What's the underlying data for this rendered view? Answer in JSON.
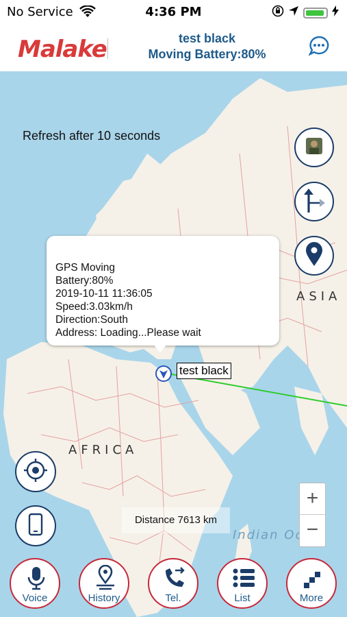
{
  "status_bar": {
    "carrier": "No Service",
    "time": "4:36 PM"
  },
  "header": {
    "logo_text": "Malake",
    "title": "test black",
    "subtitle": "Moving Battery:80%"
  },
  "map": {
    "refresh_text": "Refresh after 10 seconds",
    "labels": {
      "asia": "ASIA",
      "africa": "AFRICA",
      "indian_ocean": "Indian Ocea"
    },
    "popup": {
      "line1": "GPS Moving",
      "line2": "Battery:80%",
      "line3": "2019-10-11 11:36:05",
      "line4": "Speed:3.03km/h",
      "line5": "Direction:South",
      "line6": "Address: Loading...Please wait"
    },
    "marker_label": "test black",
    "distance_text": "Distance 7613 km",
    "zoom": {
      "in": "+",
      "out": "−"
    }
  },
  "side_buttons": [
    "avatar-icon",
    "split-route-icon",
    "location-pin-icon"
  ],
  "left_buttons": [
    "locate-target-icon",
    "phone-device-icon"
  ],
  "bottom_nav": [
    {
      "label": "Voice",
      "icon": "microphone-icon"
    },
    {
      "label": "History",
      "icon": "pin-path-icon"
    },
    {
      "label": "Tel.",
      "icon": "call-forward-icon"
    },
    {
      "label": "List",
      "icon": "list-icon"
    },
    {
      "label": "More",
      "icon": "stairs-icon"
    }
  ],
  "colors": {
    "accent": "#1e5a8a",
    "nav_border": "#c6283a",
    "route": "#2ecc2e",
    "map_water": "#a9d5ea",
    "land": "#f5f1e8"
  }
}
